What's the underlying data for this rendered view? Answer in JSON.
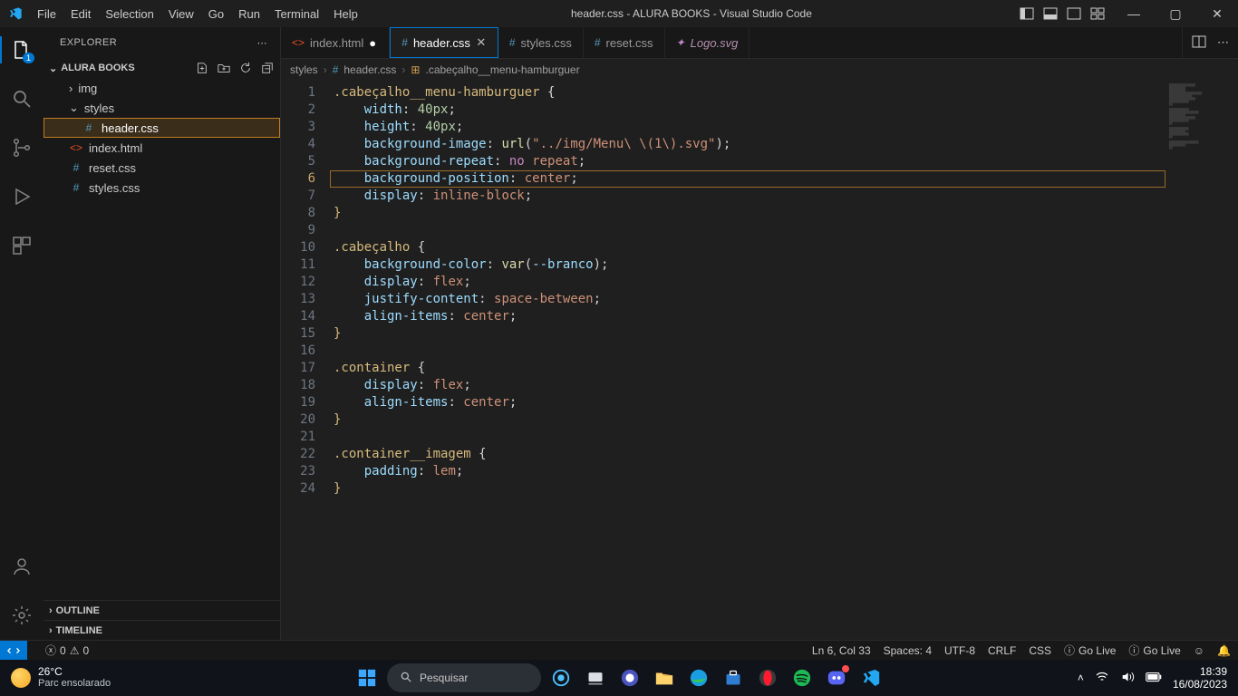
{
  "title": "header.css - ALURA BOOKS - Visual Studio Code",
  "menu": [
    "File",
    "Edit",
    "Selection",
    "View",
    "Go",
    "Run",
    "Terminal",
    "Help"
  ],
  "explorer": {
    "title": "EXPLORER",
    "project": "ALURA BOOKS",
    "outline": "OUTLINE",
    "timeline": "TIMELINE",
    "items": {
      "img": "img",
      "styles": "styles",
      "headercss": "header.css",
      "indexhtml": "index.html",
      "resetcss": "reset.css",
      "stylescss": "styles.css"
    }
  },
  "tabs": {
    "index": "index.html",
    "header": "header.css",
    "styles": "styles.css",
    "reset": "reset.css",
    "logo": "Logo.svg"
  },
  "breadcrumbs": {
    "a": "styles",
    "b": "header.css",
    "c": ".cabeçalho__menu-hamburguer"
  },
  "code": {
    "l1a": ".cabeçalho__menu-hamburguer",
    "l1b": " {",
    "l2a": "width",
    "l2b": ": ",
    "l2c": "40px",
    "l2d": ";",
    "l3a": "height",
    "l3b": ": ",
    "l3c": "40px",
    "l3d": ";",
    "l4a": "background-image",
    "l4b": ": ",
    "l4c": "url",
    "l4d": "(",
    "l4e": "\"../img/Menu\\ \\(1\\).svg\"",
    "l4f": ")",
    "l4g": ";",
    "l5a": "background-repeat",
    "l5b": ": ",
    "l5c": "no",
    "l5d": " ",
    "l5e": "repeat",
    "l5f": ";",
    "l6a": "background-position",
    "l6b": ": ",
    "l6c": "center",
    "l6d": ";",
    "l7a": "display",
    "l7b": ": ",
    "l7c": "inline-block",
    "l7d": ";",
    "l8": "}",
    "l10a": ".cabeçalho",
    "l10b": " {",
    "l11a": "background-color",
    "l11b": ": ",
    "l11c": "var",
    "l11d": "(",
    "l11e": "--branco",
    "l11f": ")",
    "l11g": ";",
    "l12a": "display",
    "l12b": ": ",
    "l12c": "flex",
    "l12d": ";",
    "l13a": "justify-content",
    "l13b": ": ",
    "l13c": "space-between",
    "l13d": ";",
    "l14a": "align-items",
    "l14b": ": ",
    "l14c": "center",
    "l14d": ";",
    "l15": "}",
    "l17a": ".container",
    "l17b": " {",
    "l18a": "display",
    "l18b": ": ",
    "l18c": "flex",
    "l18d": ";",
    "l19a": "align-items",
    "l19b": ": ",
    "l19c": "center",
    "l19d": ";",
    "l20": "}",
    "l22a": ".container__imagem",
    "l22b": " {",
    "l23a": "padding",
    "l23b": ": ",
    "l23c": "lem",
    "l23d": ";",
    "l24": "}"
  },
  "status": {
    "errors": "0",
    "warnings": "0",
    "lncol": "Ln 6, Col 33",
    "spaces": "Spaces: 4",
    "encoding": "UTF-8",
    "eol": "CRLF",
    "lang": "CSS",
    "golive1": "Go Live",
    "golive2": "Go Live"
  },
  "activity_badge": "1",
  "taskbar": {
    "temp": "26°C",
    "weather": "Parc ensolarado",
    "search": "Pesquisar",
    "time": "18:39",
    "date": "16/08/2023"
  }
}
